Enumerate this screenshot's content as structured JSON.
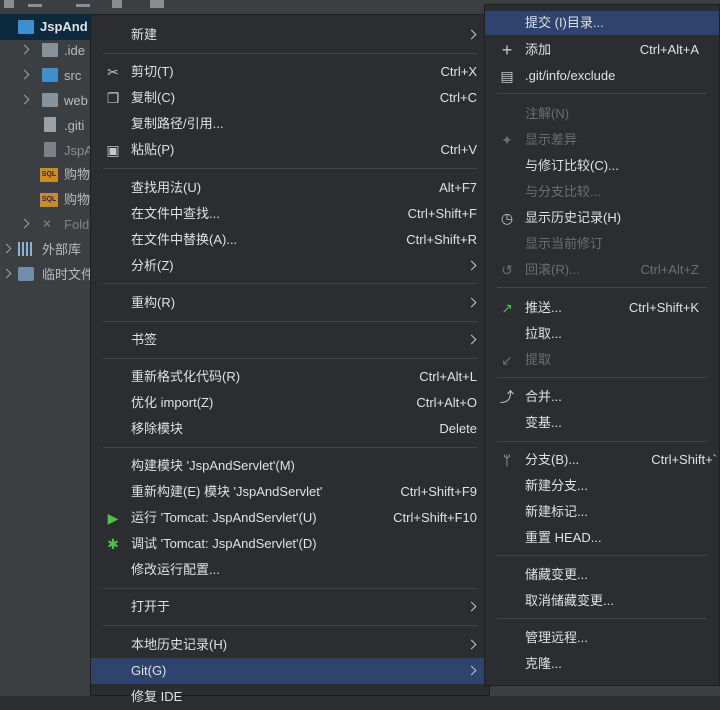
{
  "project_tree": {
    "root_label": "JspAnd",
    "items": [
      {
        "label": ".ide",
        "icon": "folder-icon"
      },
      {
        "label": "src",
        "icon": "folder-blue-icon"
      },
      {
        "label": "web",
        "icon": "web-folder-icon"
      },
      {
        "label": ".giti",
        "icon": "gitignore-file-icon"
      },
      {
        "label": "JspA",
        "icon": "iml-file-icon"
      },
      {
        "label": "购物",
        "icon": "sql-file-icon"
      },
      {
        "label": "购物",
        "icon": "sql-file-icon"
      },
      {
        "label": "Fold",
        "icon": "folder-icon"
      },
      {
        "label": "外部库",
        "icon": "library-icon"
      },
      {
        "label": "临时文件",
        "icon": "scratch-icon"
      }
    ],
    "sql_badge": "SQL"
  },
  "context_menu": {
    "items": [
      {
        "label": "新建",
        "submenu": true
      },
      {
        "label": "剪切(T)",
        "shortcut": "Ctrl+X",
        "icon": "scissors-icon"
      },
      {
        "label": "复制(C)",
        "shortcut": "Ctrl+C",
        "icon": "copy-icon"
      },
      {
        "label": "复制路径/引用..."
      },
      {
        "label": "粘贴(P)",
        "shortcut": "Ctrl+V",
        "icon": "paste-icon"
      },
      {
        "label": "查找用法(U)",
        "shortcut": "Alt+F7"
      },
      {
        "label": "在文件中查找...",
        "shortcut": "Ctrl+Shift+F"
      },
      {
        "label": "在文件中替换(A)...",
        "shortcut": "Ctrl+Shift+R"
      },
      {
        "label": "分析(Z)",
        "submenu": true
      },
      {
        "label": "重构(R)",
        "submenu": true
      },
      {
        "label": "书签",
        "submenu": true
      },
      {
        "label": "重新格式化代码(R)",
        "shortcut": "Ctrl+Alt+L"
      },
      {
        "label": "优化 import(Z)",
        "shortcut": "Ctrl+Alt+O"
      },
      {
        "label": "移除模块",
        "shortcut": "Delete"
      },
      {
        "label": "构建模块 'JspAndServlet'(M)"
      },
      {
        "label": "重新构建(E) 模块 'JspAndServlet'",
        "shortcut": "Ctrl+Shift+F9"
      },
      {
        "label": "运行 'Tomcat: JspAndServlet'(U)",
        "shortcut": "Ctrl+Shift+F10",
        "icon": "run-icon"
      },
      {
        "label": "调试 'Tomcat: JspAndServlet'(D)",
        "icon": "debug-icon"
      },
      {
        "label": "修改运行配置..."
      },
      {
        "label": "打开于",
        "submenu": true
      },
      {
        "label": "本地历史记录(H)",
        "submenu": true
      },
      {
        "label": "Git(G)",
        "submenu": true,
        "selected": true
      },
      {
        "label": "修复 IDE"
      }
    ]
  },
  "git_menu": {
    "items": [
      {
        "label": "提交 (I)目录...",
        "selected": true
      },
      {
        "label": "添加",
        "shortcut": "Ctrl+Alt+A",
        "icon": "plus-icon"
      },
      {
        "label": ".git/info/exclude",
        "icon": "git-file-icon"
      },
      {
        "label": "注解(N)",
        "disabled": true
      },
      {
        "label": "显示差异",
        "disabled": true,
        "icon": "diff-icon"
      },
      {
        "label": "与修订比较(C)..."
      },
      {
        "label": "与分支比较...",
        "disabled": true
      },
      {
        "label": "显示历史记录(H)",
        "icon": "history-icon"
      },
      {
        "label": "显示当前修订",
        "disabled": true
      },
      {
        "label": "回滚(R)...",
        "shortcut": "Ctrl+Alt+Z",
        "disabled": true,
        "icon": "rollback-icon"
      },
      {
        "label": "推送...",
        "shortcut": "Ctrl+Shift+K",
        "icon": "push-icon"
      },
      {
        "label": "拉取..."
      },
      {
        "label": "提取",
        "disabled": true,
        "icon": "fetch-icon"
      },
      {
        "label": "合并...",
        "icon": "merge-icon"
      },
      {
        "label": "变基..."
      },
      {
        "label": "分支(B)...",
        "shortcut": "Ctrl+Shift+`",
        "icon": "branch-icon"
      },
      {
        "label": "新建分支..."
      },
      {
        "label": "新建标记..."
      },
      {
        "label": "重置 HEAD..."
      },
      {
        "label": "储藏变更..."
      },
      {
        "label": "取消储藏变更..."
      },
      {
        "label": "管理远程..."
      },
      {
        "label": "克隆..."
      }
    ]
  }
}
